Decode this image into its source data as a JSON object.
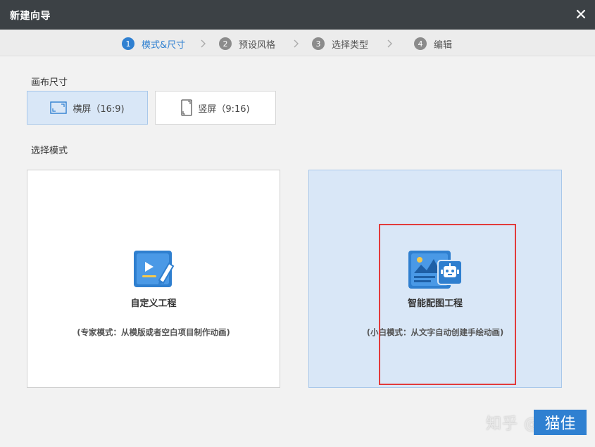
{
  "window": {
    "title": "新建向导"
  },
  "steps": [
    {
      "num": "1",
      "label": "模式&尺寸",
      "active": true
    },
    {
      "num": "2",
      "label": "预设风格",
      "active": false
    },
    {
      "num": "3",
      "label": "选择类型",
      "active": false
    },
    {
      "num": "4",
      "label": "编辑",
      "active": false
    }
  ],
  "canvas_size": {
    "label": "画布尺寸",
    "options": [
      {
        "label": "横屏（16:9)",
        "icon": "landscape-screen-icon",
        "selected": true
      },
      {
        "label": "竖屏（9:16)",
        "icon": "portrait-screen-icon",
        "selected": false
      }
    ]
  },
  "mode_select": {
    "label": "选择模式",
    "options": [
      {
        "name": "自定义工程",
        "desc": "(专家模式：从模版或者空白项目制作动画)",
        "icon": "custom-project-icon",
        "selected": false
      },
      {
        "name": "智能配图工程",
        "desc": "(小白模式：从文字自动创建手绘动画)",
        "icon": "smart-illustration-icon",
        "selected": true
      }
    ]
  },
  "watermark": "知乎 @",
  "next_button": {
    "label": "猫佳"
  },
  "colors": {
    "accent": "#2f80d1",
    "selected_bg": "#d9e7f7",
    "titlebar": "#3c4145",
    "highlight": "#e23b3b"
  }
}
